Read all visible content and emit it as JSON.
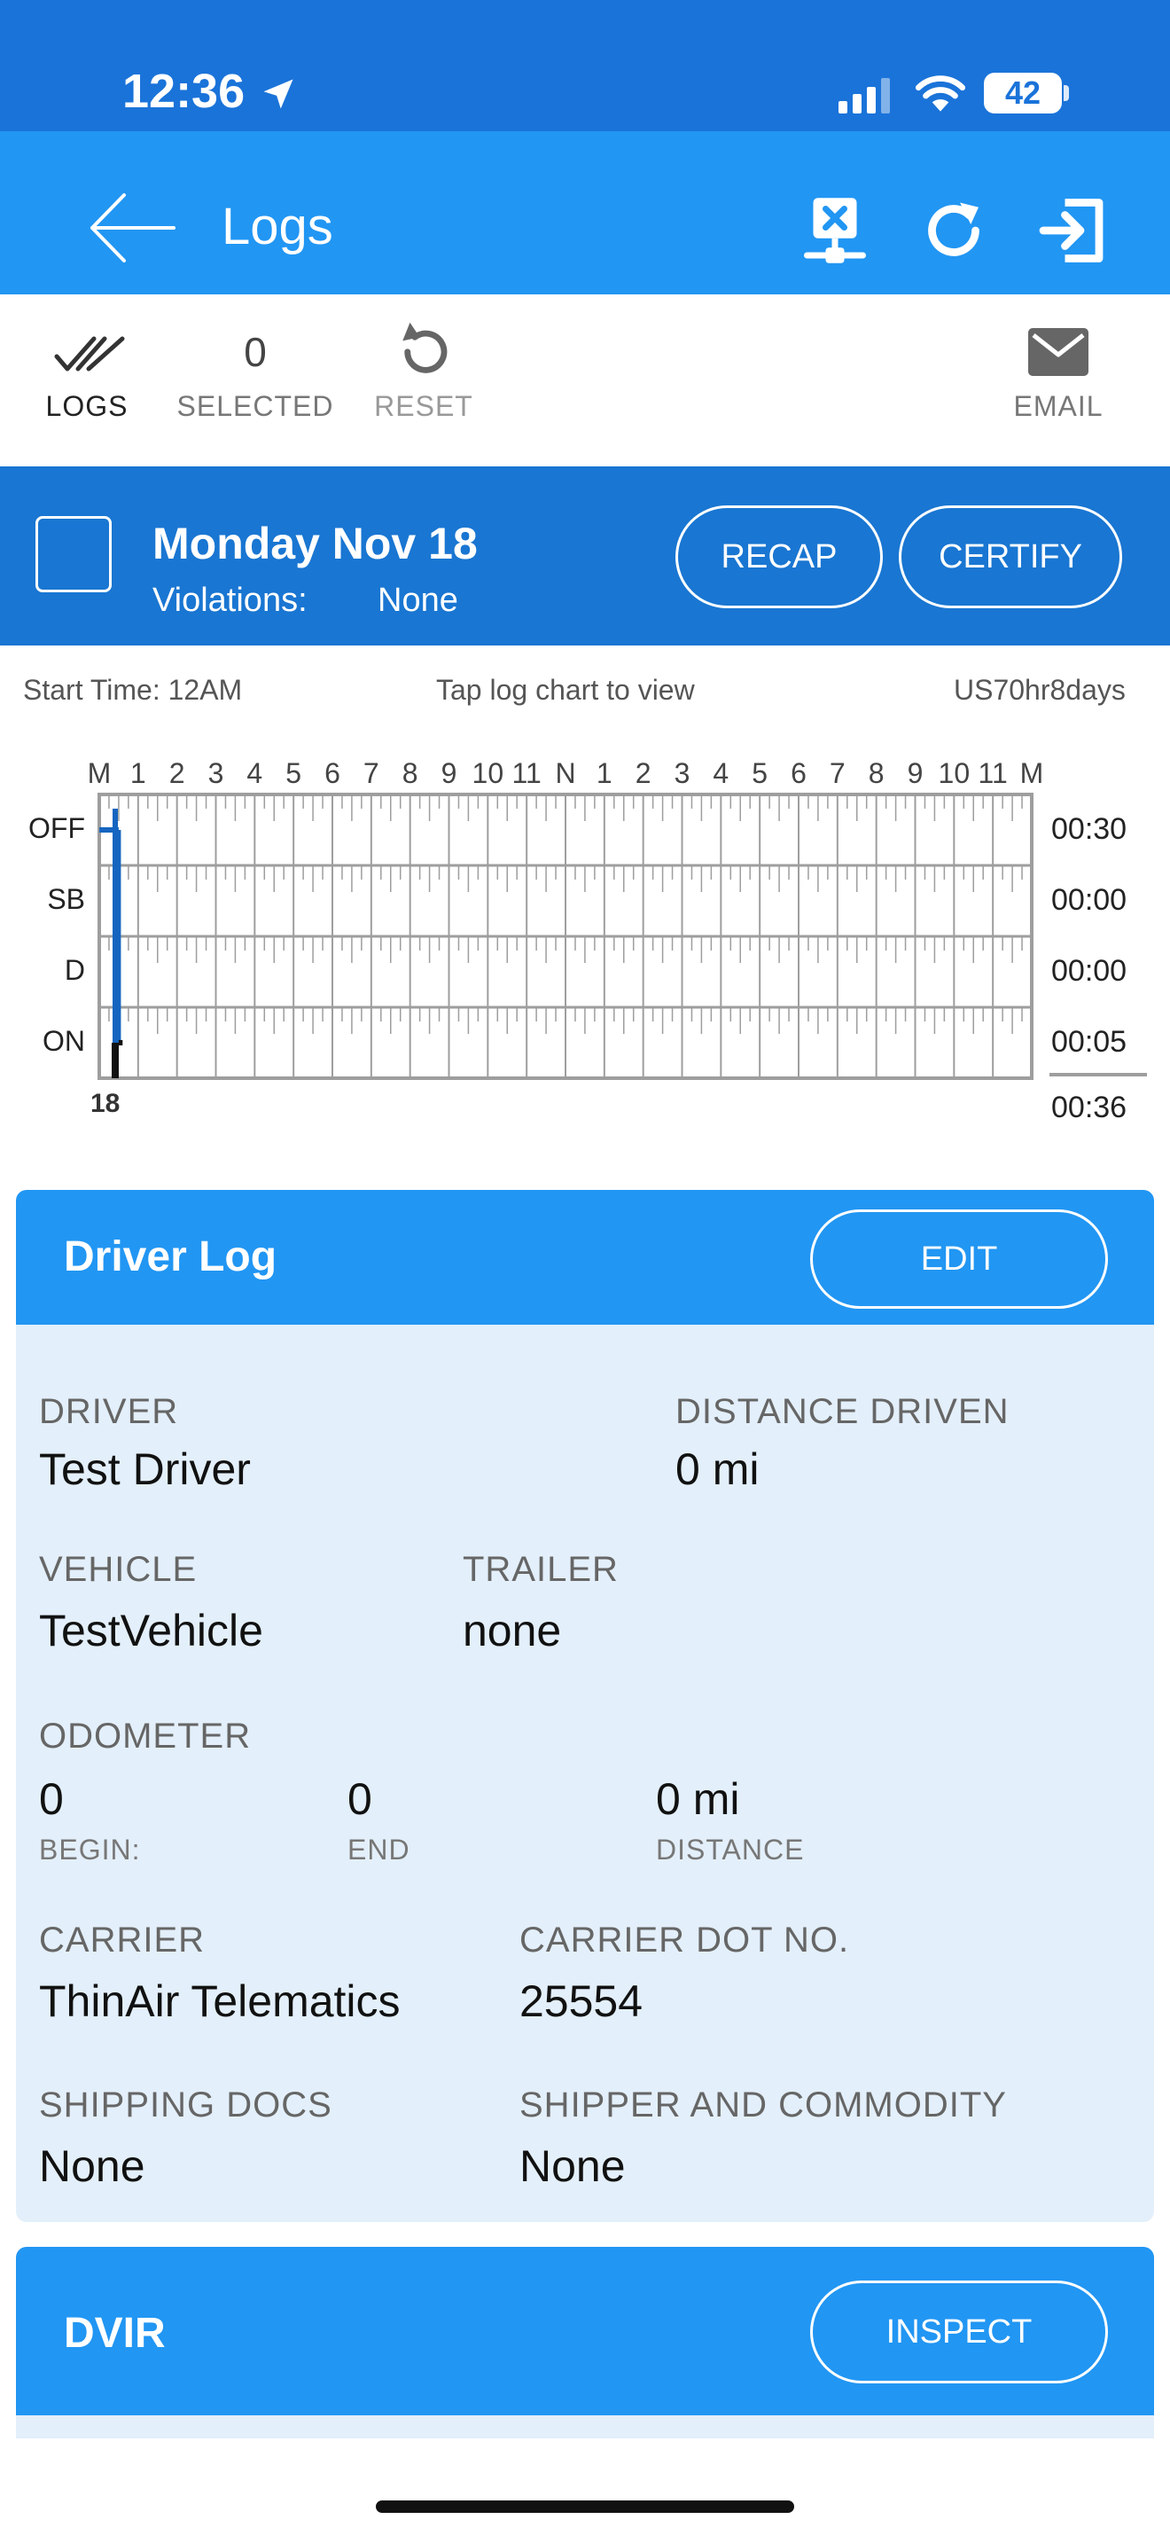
{
  "status": {
    "time": "12:36",
    "battery": "42"
  },
  "appbar": {
    "title": "Logs"
  },
  "toolbar": {
    "logs_label": "LOGS",
    "selected_count": "0",
    "selected_label": "SELECTED",
    "reset_label": "RESET",
    "email_label": "EMAIL"
  },
  "day": {
    "title": "Monday Nov 18",
    "violations_label": "Violations:",
    "violations_value": "None",
    "recap_label": "RECAP",
    "certify_label": "CERTIFY"
  },
  "chart_info": {
    "start_time": "Start Time: 12AM",
    "hint": "Tap log chart to view",
    "rule_set": "US70hr8days"
  },
  "log_chart": {
    "hour_labels": [
      "M",
      "1",
      "2",
      "3",
      "4",
      "5",
      "6",
      "7",
      "8",
      "9",
      "10",
      "11",
      "N",
      "1",
      "2",
      "3",
      "4",
      "5",
      "6",
      "7",
      "8",
      "9",
      "10",
      "11",
      "M"
    ],
    "rows": [
      {
        "label": "OFF",
        "total": "00:30"
      },
      {
        "label": "SB",
        "total": "00:00"
      },
      {
        "label": "D",
        "total": "00:00"
      },
      {
        "label": "ON",
        "total": "00:05"
      }
    ],
    "grand_total": "00:36",
    "marker_label": "18",
    "segments": [
      {
        "status": "OFF",
        "start_hour": 0.0,
        "end_hour": 0.5
      },
      {
        "status": "ON",
        "start_hour": 0.5,
        "end_hour": 0.6
      }
    ],
    "colors": {
      "off_line": "#1565c0",
      "on_line": "#111111",
      "grid": "#9e9e9e"
    }
  },
  "driver_log": {
    "title": "Driver Log",
    "edit_label": "EDIT",
    "driver_label": "DRIVER",
    "driver_value": "Test Driver",
    "distance_label": "DISTANCE DRIVEN",
    "distance_value": "0 mi",
    "vehicle_label": "VEHICLE",
    "vehicle_value": "TestVehicle",
    "trailer_label": "TRAILER",
    "trailer_value": "none",
    "odometer_label": "ODOMETER",
    "odo_begin_value": "0",
    "odo_begin_label": "BEGIN:",
    "odo_end_value": "0",
    "odo_end_label": "END",
    "odo_distance_value": "0 mi",
    "odo_distance_label": "DISTANCE",
    "carrier_label": "CARRIER",
    "carrier_value": "ThinAir Telematics",
    "dot_label": "CARRIER DOT NO.",
    "dot_value": "25554",
    "shipping_label": "SHIPPING DOCS",
    "shipping_value": "None",
    "shipper_label": "SHIPPER AND COMMODITY",
    "shipper_value": "None"
  },
  "dvir": {
    "title": "DVIR",
    "inspect_label": "INSPECT"
  }
}
